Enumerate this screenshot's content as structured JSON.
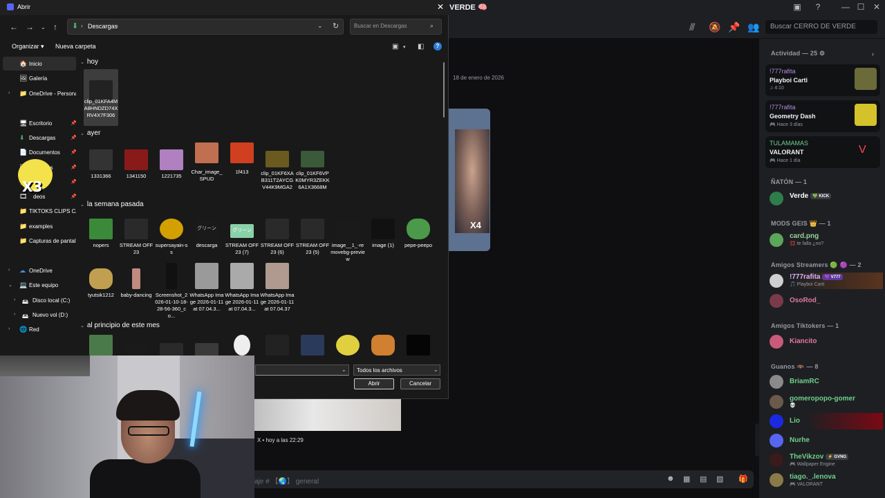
{
  "discord": {
    "server_title": "VERDE 🧠",
    "search_placeholder": "Buscar CERRO DE VERDE",
    "date_divider": "18 de enero de 2026",
    "video_overlay_text": "X4",
    "bottom_caption": "X • hoy a las 22:29",
    "input_placeholder": "aje # 【🌏】 general",
    "activity_header": "Actividad — 25 ⚙",
    "activities": [
      {
        "user": "!777rafita",
        "game": "Playboi Carti",
        "sub": "♫ 4:10",
        "thumb_color": "#6b6b3a"
      },
      {
        "user": "!777rafita",
        "game": "Geometry Dash",
        "sub": "🎮 Hace 3 días",
        "thumb_color": "#d4c22b"
      },
      {
        "user": "TULAMAMAS",
        "game": "VALORANT",
        "sub": "🎮 Hace 1 día",
        "thumb_color": "#1e1f22"
      }
    ],
    "sections": [
      {
        "label": "ÑATÓN — 1"
      },
      {
        "label": "MODS GEIS 👑 — 1"
      },
      {
        "label": "Amigos Streamers 🟢 🟣 — 2"
      },
      {
        "label": "Amigos Tiktokers — 1"
      },
      {
        "label": "Guanos 🦇 — 8"
      }
    ],
    "members": [
      {
        "name": "Verde",
        "badge": "💚 KICK",
        "sub": "",
        "color": "#ffffff",
        "avatar": "#2f7d4a"
      },
      {
        "name": "card.png",
        "badge": "",
        "sub": "💢 te falla ¿no?",
        "color": "#9ad29a",
        "avatar": "#5aa65a"
      },
      {
        "name": "!777rafita",
        "badge": "💜 V777",
        "sub": "🎵 Playboi Carti",
        "color": "#d9b0ff",
        "avatar": "#cfcfcf"
      },
      {
        "name": "OsoRod_",
        "badge": "",
        "sub": "",
        "color": "#e07aa0",
        "avatar": "#7a3a4a"
      },
      {
        "name": "Kiancito",
        "badge": "",
        "sub": "",
        "color": "#e07aa0",
        "avatar": "#c85a7a"
      },
      {
        "name": "BriamRC",
        "badge": "",
        "sub": "",
        "color": "#6fd08c",
        "avatar": "#8a8a8a"
      },
      {
        "name": "gomeropopo-gomer",
        "badge": "",
        "sub": "💀",
        "color": "#6fd08c",
        "avatar": "#6a5a4a"
      },
      {
        "name": "Lio",
        "badge": "",
        "sub": "",
        "color": "#6fd08c",
        "avatar": "#1a2ae0"
      },
      {
        "name": "Nurhe",
        "badge": "",
        "sub": "",
        "color": "#6fd08c",
        "avatar": "#5865f2"
      },
      {
        "name": "TheVikzov",
        "badge": "⚡ GVNG",
        "sub": "🎮 Wallpaper Engine",
        "color": "#6fd08c",
        "avatar": "#3a1a1a"
      },
      {
        "name": "tiago._.lenova",
        "badge": "",
        "sub": "🎮 VALORANT",
        "color": "#6fd08c",
        "avatar": "#8a7a4a"
      }
    ],
    "colors": {
      "bg": "#313338",
      "sidebar": "#1e1f22",
      "chat": "#0f0f11",
      "accent": "#5865f2"
    }
  },
  "dialog": {
    "title": "Abrir",
    "address": "Descargas",
    "search_placeholder": "Buscar en Descargas",
    "organize": "Organizar ▾",
    "new_folder": "Nueva carpeta",
    "nav": [
      {
        "label": "Inicio",
        "icon": "home-icon",
        "glyph": "🏠",
        "pin": ""
      },
      {
        "label": "Galería",
        "icon": "gallery-icon",
        "glyph": "🖼",
        "pin": ""
      },
      {
        "label": "OneDrive - Persona",
        "icon": "folder-icon",
        "glyph": "📁",
        "pin": ""
      },
      {
        "label": "Escritorio",
        "icon": "desktop-icon",
        "glyph": "🖥",
        "pin": "📌"
      },
      {
        "label": "Descargas",
        "icon": "download-icon",
        "glyph": "⬇",
        "pin": "📌"
      },
      {
        "label": "Documentos",
        "icon": "documents-icon",
        "glyph": "📄",
        "pin": "📌"
      },
      {
        "label": "es",
        "icon": "images-icon",
        "glyph": "🖼",
        "pin": "📌"
      },
      {
        "label": "",
        "icon": "music-icon",
        "glyph": "🎵",
        "pin": "📌"
      },
      {
        "label": "deos",
        "icon": "video-icon",
        "glyph": "🎞",
        "pin": "📌"
      },
      {
        "label": "TIKTOKS CLIPS CAP",
        "icon": "folder-icon",
        "glyph": "📁",
        "pin": ""
      },
      {
        "label": "examples",
        "icon": "folder-icon",
        "glyph": "📁",
        "pin": ""
      },
      {
        "label": "Capturas de pantall",
        "icon": "folder-icon",
        "glyph": "📁",
        "pin": ""
      },
      {
        "label": "OneDrive",
        "icon": "cloud-icon",
        "glyph": "☁",
        "pin": ""
      },
      {
        "label": "Este equipo",
        "icon": "computer-icon",
        "glyph": "💻",
        "pin": ""
      },
      {
        "label": "Disco local (C:)",
        "icon": "drive-icon",
        "glyph": "🖴",
        "pin": ""
      },
      {
        "label": "Nuevo vol (D:)",
        "icon": "drive-icon",
        "glyph": "🖴",
        "pin": ""
      },
      {
        "label": "Red",
        "icon": "network-icon",
        "glyph": "🌐",
        "pin": ""
      }
    ],
    "groups": [
      {
        "label": "hoy",
        "files": [
          {
            "name": "clip_01KFA4MA8HNDZD74XRV4X7F306",
            "color": "#222"
          }
        ]
      },
      {
        "label": "ayer",
        "files": [
          {
            "name": "1331366",
            "color": "#333"
          },
          {
            "name": "1341150",
            "color": "#8a1a1a"
          },
          {
            "name": "1221735",
            "color": "#b080c0"
          },
          {
            "name": "Char_image_SPUD",
            "color": "#c07050"
          },
          {
            "name": "1f413",
            "color": "#d04020"
          },
          {
            "name": "clip_01KF6XAB311T2AYCGV44K9MGA2",
            "color": "#6a5a20"
          },
          {
            "name": "clip_01KF6VPK0MYR3ZEKK6A1X3668M",
            "color": "#3a5a3a"
          }
        ]
      },
      {
        "label": "la semana pasada",
        "files": [
          {
            "name": "nopers",
            "color": "#3a8a3a"
          },
          {
            "name": "STREAM OFF 23",
            "color": "#2a2a2a"
          },
          {
            "name": "supersayain-ss",
            "color": "#d4a000"
          },
          {
            "name": "descarga",
            "color": "#1a1a1a"
          },
          {
            "name": "STREAM OFF 23 (7)",
            "color": "#8ad0a8"
          },
          {
            "name": "STREAM OFF 23 (6)",
            "color": "#2a2a2a"
          },
          {
            "name": "STREAM OFF 23 (5)",
            "color": "#2a2a2a"
          },
          {
            "name": "image__1_-removebg-preview",
            "color": "#1a1a1a"
          },
          {
            "name": "image (1)",
            "color": "#111"
          },
          {
            "name": "pepe-peepo",
            "color": "#4a9a4a"
          },
          {
            "name": "tyutsik1212",
            "color": "#c0a050"
          },
          {
            "name": "baby-dancing",
            "color": "#c08a80"
          },
          {
            "name": "Screenshot_2026-01-10-18-28-56-360_co...",
            "color": "#111"
          },
          {
            "name": "WhatsApp Image 2026-01-11 at 07.04.3...",
            "color": "#9a9a9a"
          },
          {
            "name": "WhatsApp Image 2026-01-11 at 07.04.3...",
            "color": "#aaaaaa"
          },
          {
            "name": "WhatsApp Image 2026-01-11 at 07.04.37",
            "color": "#b09a90"
          }
        ]
      },
      {
        "label": "al principio de este mes",
        "files": [
          {
            "name": "",
            "color": "#4a7a4a"
          },
          {
            "name": "",
            "color": "#1a1a1a"
          },
          {
            "name": "",
            "color": "#2a2a2a"
          },
          {
            "name": "",
            "color": "#3a3a3a"
          },
          {
            "name": "",
            "color": "#eeeeee"
          },
          {
            "name": "",
            "color": "#222"
          },
          {
            "name": "",
            "color": "#2a3a5a"
          },
          {
            "name": "",
            "color": "#e0d040"
          },
          {
            "name": "",
            "color": "#d08030"
          },
          {
            "name": "",
            "color": "#050505"
          }
        ]
      }
    ],
    "file_type_filter": "Todos los archivos",
    "open_label": "Abrir",
    "cancel_label": "Cancelar"
  },
  "webcam": {
    "sticker_text": "X3"
  }
}
